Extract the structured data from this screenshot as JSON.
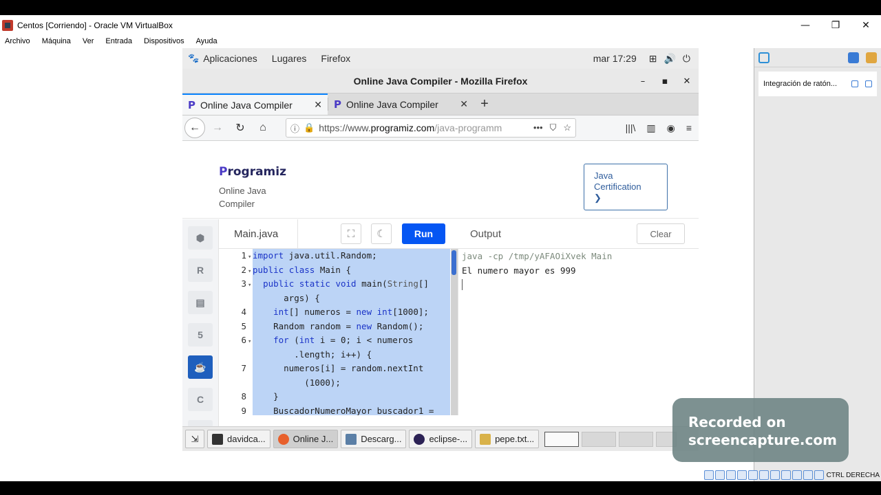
{
  "vbox": {
    "title": "Centos [Corriendo] - Oracle VM VirtualBox",
    "menu": [
      "Archivo",
      "Máquina",
      "Ver",
      "Entrada",
      "Dispositivos",
      "Ayuda"
    ],
    "side_panel_item": "Integración de ratón...",
    "host_key": "CTRL DERECHA"
  },
  "gnome": {
    "menu": [
      "Aplicaciones",
      "Lugares",
      "Firefox"
    ],
    "clock": "mar 17:29"
  },
  "firefox": {
    "window_title": "Online Java Compiler - Mozilla Firefox",
    "tabs": [
      {
        "label": "Online Java Compiler"
      },
      {
        "label": "Online Java Compiler"
      }
    ],
    "url_prefix": "https://www.",
    "url_domain": "programiz.com",
    "url_suffix": "/java-programm"
  },
  "page": {
    "logo": "rogramiz",
    "subtitle": "Online Java Compiler",
    "cert_line1": "Java",
    "cert_line2": "Certification",
    "cert_arrow": "❯",
    "file_tab": "Main.java",
    "run_label": "Run",
    "output_label": "Output",
    "clear_label": "Clear",
    "output_cmd": "java -cp /tmp/yAFAOiXvek Main",
    "output_result": "El numero mayor es 999"
  },
  "code_lines": [
    {
      "n": "1",
      "fold": true,
      "text": "import java.util.Random;"
    },
    {
      "n": "2",
      "fold": true,
      "text": "public class Main {"
    },
    {
      "n": "3",
      "fold": true,
      "text": "  public static void main(String[]"
    },
    {
      "n": "",
      "fold": false,
      "text": "      args) {"
    },
    {
      "n": "4",
      "fold": false,
      "text": "    int[] numeros = new int[1000];"
    },
    {
      "n": "5",
      "fold": false,
      "text": "    Random random = new Random();"
    },
    {
      "n": "6",
      "fold": true,
      "text": "    for (int i = 0; i < numeros"
    },
    {
      "n": "",
      "fold": false,
      "text": "        .length; i++) {"
    },
    {
      "n": "7",
      "fold": false,
      "text": "      numeros[i] = random.nextInt"
    },
    {
      "n": "",
      "fold": false,
      "text": "          (1000);"
    },
    {
      "n": "8",
      "fold": false,
      "text": "    }"
    },
    {
      "n": "9",
      "fold": false,
      "text": "    BuscadorNumeroMayor buscador1 ="
    }
  ],
  "taskbar": [
    {
      "label": "davidca...",
      "icon": "terminal-icon"
    },
    {
      "label": "Online J...",
      "icon": "firefox-icon"
    },
    {
      "label": "Descarg...",
      "icon": "file-manager-icon"
    },
    {
      "label": "eclipse-...",
      "icon": "eclipse-icon"
    },
    {
      "label": "pepe.txt...",
      "icon": "text-editor-icon"
    }
  ],
  "watermark": {
    "line1": "Recorded on",
    "line2": "screencapture.com"
  },
  "colors": {
    "run_button": "#0556f3",
    "selection": "#bcd4f6",
    "active_lang": "#1f5fbd",
    "tab_accent": "#0a84ff"
  }
}
